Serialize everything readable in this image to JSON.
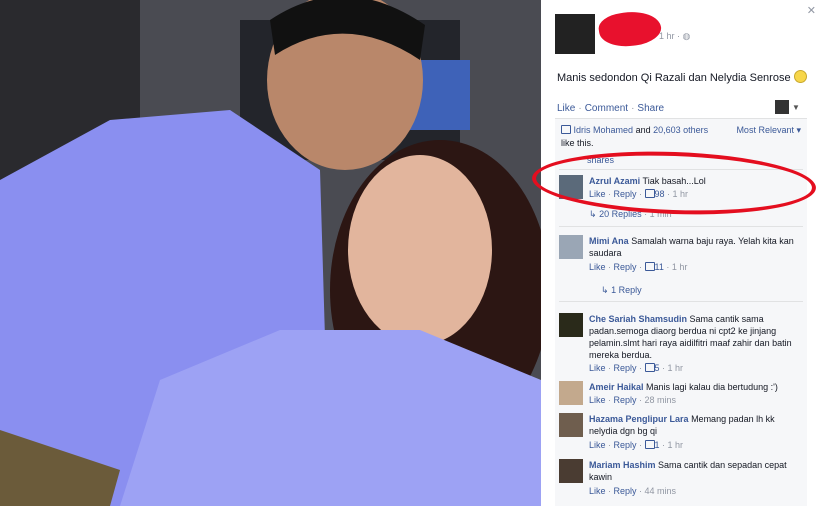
{
  "post": {
    "time": "1 hr",
    "caption": "Manis sedondon Qi Razali dan Nelydia Senrose",
    "actions": {
      "like": "Like",
      "comment": "Comment",
      "share": "Share"
    },
    "likes": {
      "name": "Idris Mohamed",
      "and": "and",
      "others": "20,603 others",
      "suffix": "like this."
    },
    "sort": "Most Relevant",
    "shares": "shares"
  },
  "comments": [
    {
      "name": "Azrul Azami",
      "text": "Tiak basah...Lol",
      "like": "Like",
      "reply": "Reply",
      "likes": "98",
      "time": "1 hr",
      "replies": "20 Replies",
      "replies_time": "1 min"
    },
    {
      "name": "Mimi Ana",
      "text": "Samalah warna baju raya. Yelah kita kan saudara",
      "like": "Like",
      "reply": "Reply",
      "likes": "11",
      "time": "1 hr",
      "replies": "1 Reply"
    },
    {
      "name": "Che Sariah Shamsudin",
      "text": "Sama cantik sama padan.semoga diaorg berdua ni cpt2 ke jinjang pelamin.slmt hari raya aidilfitri maaf zahir dan batin mereka berdua.",
      "like": "Like",
      "reply": "Reply",
      "likes": "5",
      "time": "1 hr"
    },
    {
      "name": "Ameir Haikal",
      "text": "Manis lagi kalau dia bertudung :')",
      "like": "Like",
      "reply": "Reply",
      "time": "28 mins"
    },
    {
      "name": "Hazama Penglipur Lara",
      "text": "Memang padan lh kk nelydia dgn bg qi",
      "like": "Like",
      "reply": "Reply",
      "likes": "1",
      "time": "1 hr"
    },
    {
      "name": "Mariam Hashim",
      "text": "Sama cantik dan sepadan cepat kawin",
      "like": "Like",
      "reply": "Reply",
      "time": "44 mins"
    }
  ],
  "icons": {
    "close": "close-icon",
    "globe": "globe-icon",
    "thumb": "thumbs-up-icon"
  },
  "colors": {
    "link": "#3b5998",
    "highlight": "#e40e1f",
    "shirt": "#8a8ff0"
  }
}
